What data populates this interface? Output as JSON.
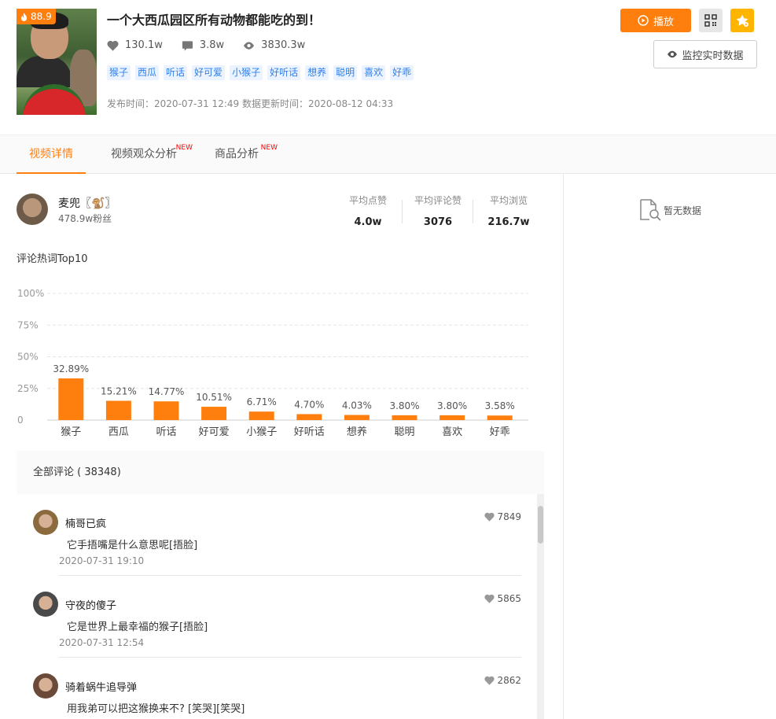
{
  "video": {
    "hot_score": "88.9",
    "title": "一个大西瓜园区所有动物都能吃的到！",
    "likes": "130.1w",
    "comments": "3.8w",
    "views": "3830.3w",
    "tags": [
      "猴子",
      "西瓜",
      "听话",
      "好可爱",
      "小猴子",
      "好听话",
      "想养",
      "聪明",
      "喜欢",
      "好乖"
    ],
    "publish_time": "发布时间：2020-07-31 12:49 数据更新时间：2020-08-12 04:33"
  },
  "actions": {
    "play_label": "播放",
    "monitor_label": "监控实时数据"
  },
  "tabs": [
    {
      "label": "视频详情",
      "new": ""
    },
    {
      "label": "视频观众分析",
      "new": "NEW"
    },
    {
      "label": "商品分析",
      "new": "NEW"
    }
  ],
  "author": {
    "name": "麦兜〖🐒〗",
    "fans": "478.9w粉丝",
    "avg_like_label": "平均点赞",
    "avg_like": "4.0w",
    "avg_comment_like_label": "平均评论赞",
    "avg_comment_like": "3076",
    "avg_view_label": "平均浏览",
    "avg_view": "216.7w"
  },
  "chart_title": "评论热词Top10",
  "chart_data": {
    "type": "bar",
    "categories": [
      "猴子",
      "西瓜",
      "听话",
      "好可爱",
      "小猴子",
      "好听话",
      "想养",
      "聪明",
      "喜欢",
      "好乖"
    ],
    "values": [
      32.89,
      15.21,
      14.77,
      10.51,
      6.71,
      4.7,
      4.03,
      3.8,
      3.8,
      3.58
    ],
    "data_labels": [
      "32.89%",
      "15.21%",
      "14.77%",
      "10.51%",
      "6.71%",
      "4.70%",
      "4.03%",
      "3.80%",
      "3.80%",
      "3.58%"
    ],
    "yticks": [
      "0",
      "25%",
      "50%",
      "75%",
      "100%"
    ],
    "ylim": [
      0,
      100
    ],
    "bar_color": "#ff7f0e",
    "grid": true
  },
  "comments_section": {
    "header": "全部评论 ( 38348)",
    "items": [
      {
        "user": "楠哥已疯",
        "likes": "7849",
        "text": "它手捂嘴是什么意思呢[捂脸]",
        "date": "2020-07-31 19:10"
      },
      {
        "user": "守夜的傻子",
        "likes": "5865",
        "text": "它是世界上最幸福的猴子[捂脸]",
        "date": "2020-07-31 12:54"
      },
      {
        "user": "骑着蜗牛追导弹",
        "likes": "2862",
        "text": "用我弟可以把这猴换来不? [笑哭][笑哭]",
        "date": ""
      }
    ]
  },
  "side_panel": {
    "no_data": "暂无数据"
  },
  "colors": {
    "accent": "#ff7f0e",
    "tag_bg": "#eaf3ff",
    "tag_text": "#2f80ed",
    "star_btn": "#ffb400"
  }
}
